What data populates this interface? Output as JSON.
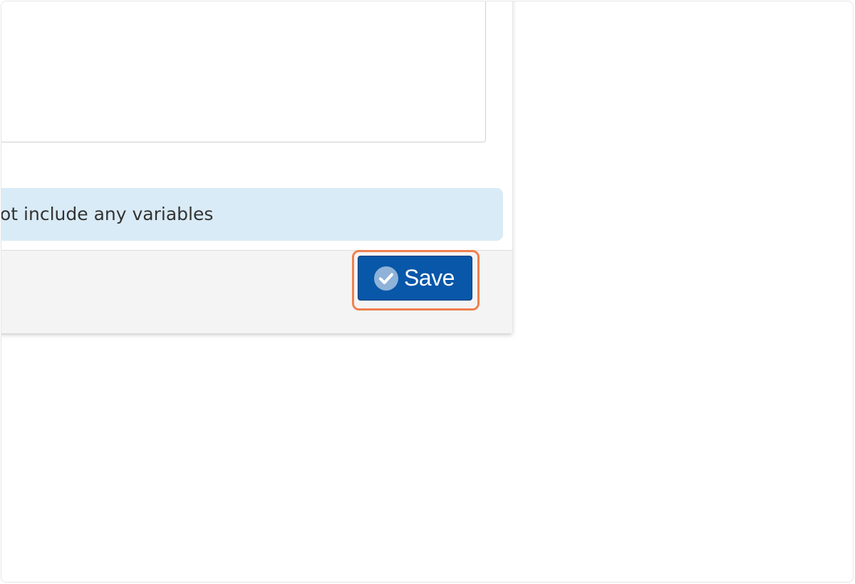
{
  "info_banner": {
    "text": "ot include any variables"
  },
  "footer": {
    "save_label": "Save",
    "save_icon": "check-circle-icon"
  },
  "colors": {
    "save_button_bg": "#0857a8",
    "highlight_border": "#f07f50",
    "info_banner_bg": "#d9ebf6",
    "footer_bg": "#f4f4f4"
  }
}
